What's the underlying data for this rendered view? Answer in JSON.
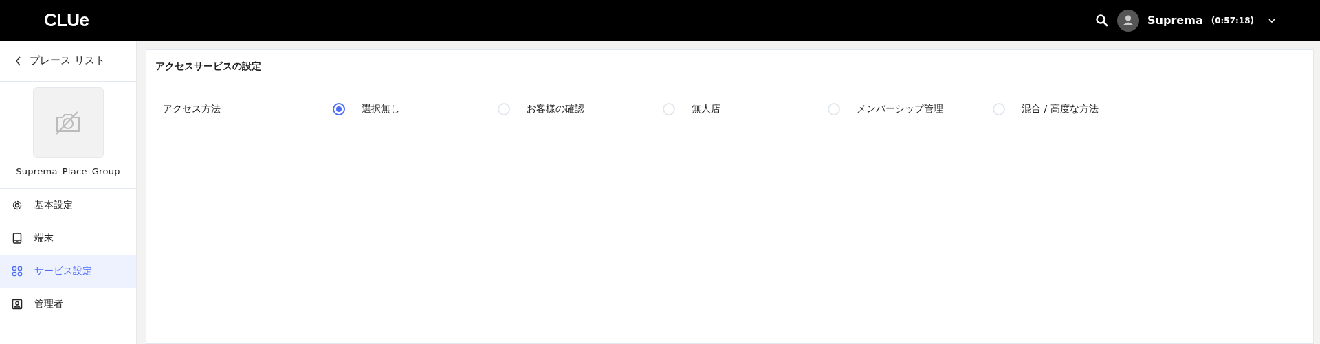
{
  "header": {
    "logo": "CLUe",
    "user": {
      "name": "Suprema",
      "session_time": "(0:57:18)"
    }
  },
  "sidebar": {
    "back_link": "プレース リスト",
    "place_name": "Suprema_Place_Group",
    "items": [
      {
        "label": "基本設定",
        "kind": "gear",
        "selected": false
      },
      {
        "label": "端末",
        "kind": "device",
        "selected": false
      },
      {
        "label": "サービス設定",
        "kind": "grid",
        "selected": true
      },
      {
        "label": "管理者",
        "kind": "person",
        "selected": false
      }
    ]
  },
  "panel": {
    "title": "アクセスサービスの設定",
    "field_label": "アクセス方法",
    "options": [
      {
        "label": "選択無し",
        "selected": true
      },
      {
        "label": "お客様の確認",
        "selected": false
      },
      {
        "label": "無人店",
        "selected": false
      },
      {
        "label": "メンバーシップ管理",
        "selected": false
      },
      {
        "label": "混合 / 高度な方法",
        "selected": false
      }
    ]
  }
}
